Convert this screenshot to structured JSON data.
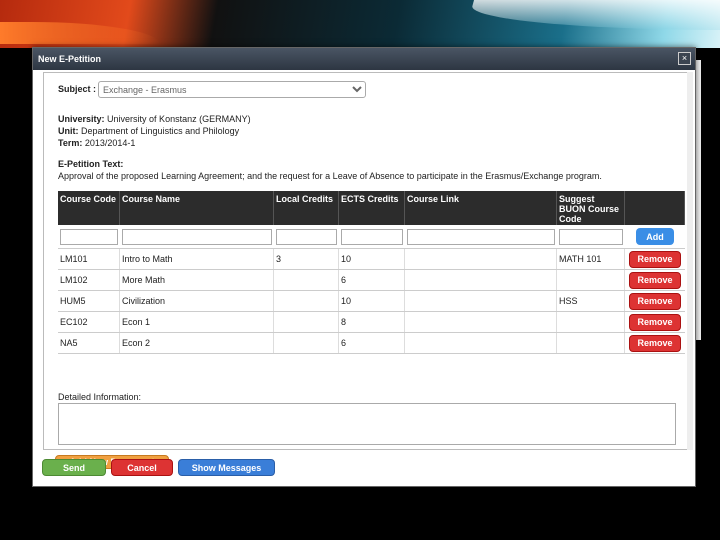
{
  "dialog": {
    "title": "New E-Petition",
    "close_glyph": "×"
  },
  "subject": {
    "label": "Subject :",
    "value": "Exchange - Erasmus"
  },
  "info": {
    "university_label": "University:",
    "university_value": "University of Konstanz (GERMANY)",
    "unit_label": "Unit:",
    "unit_value": "Department of Linguistics and Philology",
    "term_label": "Term:",
    "term_value": "2013/2014-1",
    "petition_label": "E-Petition Text:",
    "petition_text": "Approval of the proposed Learning Agreement; and the request for a Leave of Absence to participate in the Erasmus/Exchange program."
  },
  "table": {
    "headers": [
      "Course Code",
      "Course Name",
      "Local Credits",
      "ECTS Credits",
      "Course Link",
      "Suggest BUON Course Code",
      ""
    ],
    "add_label": "Add",
    "remove_label": "Remove",
    "rows": [
      {
        "code": "LM101",
        "name": "Intro to Math",
        "local": "3",
        "ects": "10",
        "link": "",
        "suggest": "MATH 101"
      },
      {
        "code": "LM102",
        "name": "More Math",
        "local": "",
        "ects": "6",
        "link": "",
        "suggest": ""
      },
      {
        "code": "HUM5",
        "name": "Civilization",
        "local": "",
        "ects": "10",
        "link": "",
        "suggest": "HSS"
      },
      {
        "code": "EC102",
        "name": "Econ 1",
        "local": "",
        "ects": "8",
        "link": "",
        "suggest": ""
      },
      {
        "code": "NA5",
        "name": "Econ 2",
        "local": "",
        "ects": "6",
        "link": "",
        "suggest": ""
      }
    ]
  },
  "details": {
    "label": "Detailed Information:"
  },
  "buttons": {
    "add_document": "Add New Document",
    "send": "Send",
    "cancel": "Cancel",
    "show_messages": "Show Messages"
  },
  "colors": {
    "header_bg": "#2c2c2c",
    "add": "#3a8ee6",
    "remove": "#dd3333",
    "send": "#6ab04c",
    "document": "#f0a040"
  }
}
